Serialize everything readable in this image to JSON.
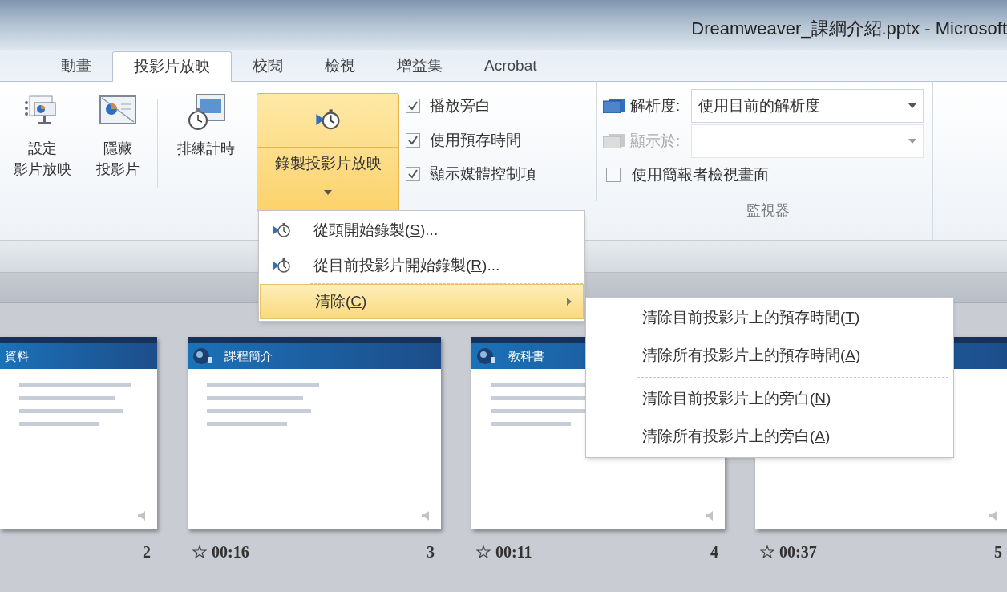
{
  "window": {
    "title": "Dreamweaver_課綱介紹.pptx - Microsoft"
  },
  "tabs": [
    {
      "label": "動畫",
      "selected": false
    },
    {
      "label": "投影片放映",
      "selected": true
    },
    {
      "label": "校閱",
      "selected": false
    },
    {
      "label": "檢視",
      "selected": false
    },
    {
      "label": "增益集",
      "selected": false
    },
    {
      "label": "Acrobat",
      "selected": false
    }
  ],
  "ribbon": {
    "buttons": [
      {
        "kind": "setup",
        "lines": [
          "設定",
          "影片放映"
        ]
      },
      {
        "kind": "hide",
        "lines": [
          "隱藏",
          "投影片"
        ]
      },
      {
        "kind": "rehearse",
        "lines": [
          "排練計時"
        ]
      },
      {
        "kind": "record",
        "lines": [
          "錄製投影片放映"
        ],
        "selected": true
      }
    ],
    "checkboxes": [
      {
        "label": "播放旁白",
        "checked": true
      },
      {
        "label": "使用預存時間",
        "checked": true
      },
      {
        "label": "顯示媒體控制項",
        "checked": true
      }
    ],
    "monitors": {
      "resolution": {
        "label": "解析度:",
        "value": "使用目前的解析度",
        "disabled": false
      },
      "show_on": {
        "label": "顯示於:",
        "disabled": true
      },
      "presenter_view": {
        "label": "使用簡報者檢視畫面",
        "checked": false
      },
      "group_label": "監視器"
    }
  },
  "record_menu": [
    {
      "before": "從頭開始錄製(",
      "key": "S",
      "after": ")...",
      "kind": "command",
      "selected": false
    },
    {
      "before": "從目前投影片開始錄製(",
      "key": "R",
      "after": ")...",
      "kind": "command",
      "selected": false
    },
    {
      "before": "清除(",
      "key": "C",
      "after": ")",
      "kind": "submenu",
      "selected": true
    }
  ],
  "clear_submenu": [
    {
      "before": "清除目前投影片上的預存時間(",
      "key": "T",
      "after": ")"
    },
    {
      "before": "清除所有投影片上的預存時間(",
      "key": "A",
      "after": ")"
    },
    {
      "before": "清除目前投影片上的旁白(",
      "key": "N",
      "after": ")"
    },
    {
      "before": "清除所有投影片上的旁白(",
      "key": "A",
      "after": ")"
    }
  ],
  "slides": [
    {
      "title": "資料",
      "number": "2"
    },
    {
      "title": "課程簡介",
      "time": "00:16",
      "number": "3"
    },
    {
      "title": "教科書",
      "time": "00:11",
      "number": "4"
    },
    {
      "time": "00:37",
      "number": "5"
    }
  ]
}
